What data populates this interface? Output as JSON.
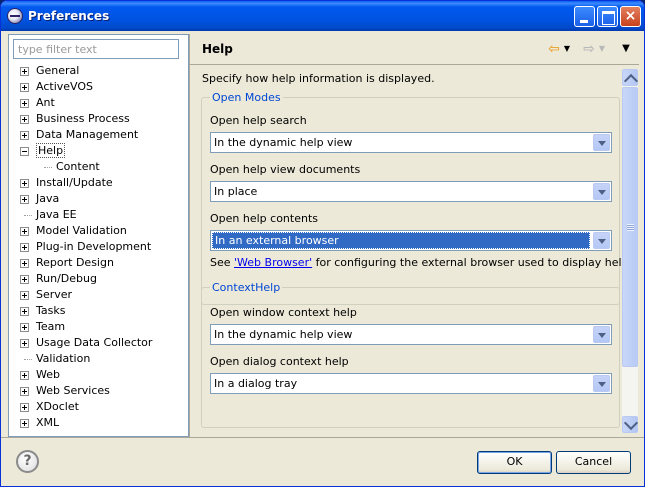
{
  "window": {
    "title": "Preferences",
    "icon": "eclipse-icon",
    "controls": {
      "minimize": "minimize",
      "maximize": "maximize",
      "close": "×"
    }
  },
  "sidebar": {
    "filter_placeholder": "type filter text",
    "items": [
      {
        "label": "General",
        "state": "collapsed"
      },
      {
        "label": "ActiveVOS",
        "state": "collapsed"
      },
      {
        "label": "Ant",
        "state": "collapsed"
      },
      {
        "label": "Business Process",
        "state": "collapsed"
      },
      {
        "label": "Data Management",
        "state": "collapsed"
      },
      {
        "label": "Help",
        "state": "expanded",
        "selected": true
      },
      {
        "label": "Content",
        "state": "leaf",
        "child": true
      },
      {
        "label": "Install/Update",
        "state": "collapsed"
      },
      {
        "label": "Java",
        "state": "collapsed"
      },
      {
        "label": "Java EE",
        "state": "leaf"
      },
      {
        "label": "Model Validation",
        "state": "collapsed"
      },
      {
        "label": "Plug-in Development",
        "state": "collapsed"
      },
      {
        "label": "Report Design",
        "state": "collapsed"
      },
      {
        "label": "Run/Debug",
        "state": "collapsed"
      },
      {
        "label": "Server",
        "state": "collapsed"
      },
      {
        "label": "Tasks",
        "state": "collapsed"
      },
      {
        "label": "Team",
        "state": "collapsed"
      },
      {
        "label": "Usage Data Collector",
        "state": "collapsed"
      },
      {
        "label": "Validation",
        "state": "leaf"
      },
      {
        "label": "Web",
        "state": "collapsed"
      },
      {
        "label": "Web Services",
        "state": "collapsed"
      },
      {
        "label": "XDoclet",
        "state": "collapsed"
      },
      {
        "label": "XML",
        "state": "collapsed"
      }
    ]
  },
  "page": {
    "title": "Help",
    "intro": "Specify how help information is displayed.",
    "open_modes": {
      "legend": "Open Modes",
      "search_label": "Open help search",
      "search_value": "In the dynamic help view",
      "documents_label": "Open help view documents",
      "documents_value": "In place",
      "contents_label": "Open help contents",
      "contents_value": "In an external browser",
      "note_prefix": "See ",
      "note_link": "'Web Browser'",
      "note_suffix": " for configuring the external browser used to display help topics."
    },
    "context_help": {
      "legend": "ContextHelp",
      "window_label": "Open window context help",
      "window_value": "In the dynamic help view",
      "dialog_label": "Open dialog context help",
      "dialog_value": "In a dialog tray"
    }
  },
  "footer": {
    "help_glyph": "?",
    "ok_label": "OK",
    "cancel_label": "Cancel"
  }
}
